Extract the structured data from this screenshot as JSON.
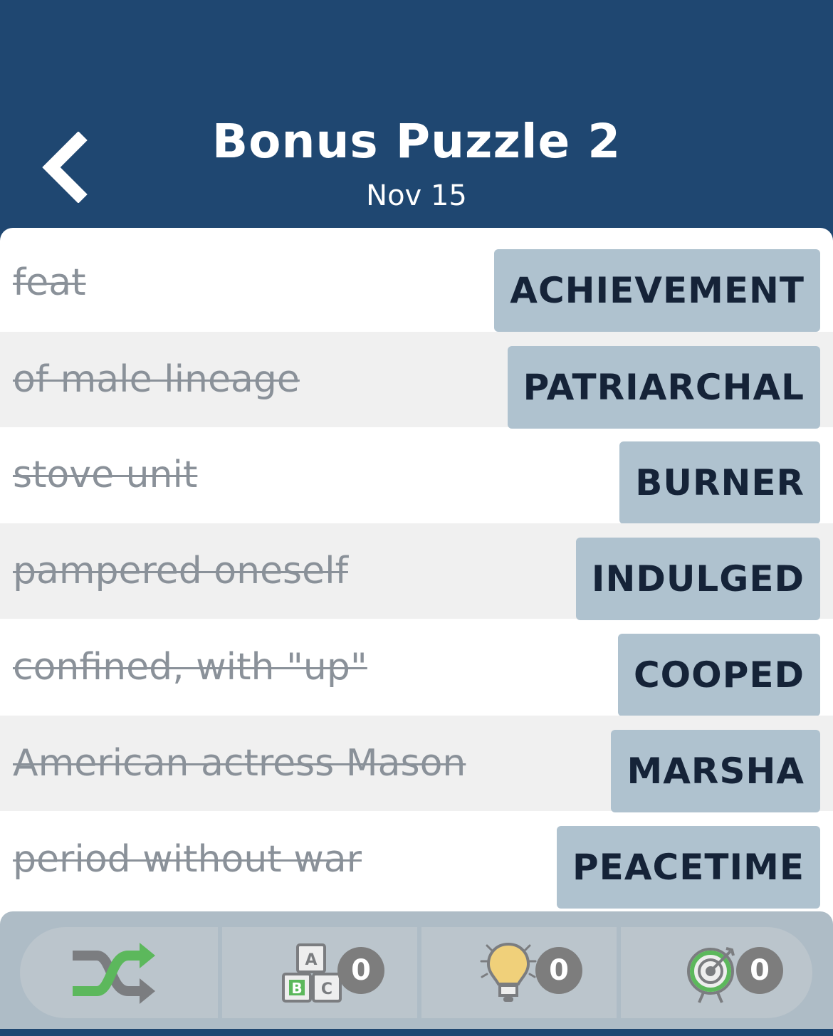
{
  "header": {
    "title": "Bonus Puzzle 2",
    "date": "Nov 15",
    "background_color": "#1f4771"
  },
  "clues": [
    {
      "clue": "feat",
      "answer": "ACHIEVEMENT",
      "solved": true
    },
    {
      "clue": "of male lineage",
      "answer": "PATRIARCHAL",
      "solved": true
    },
    {
      "clue": "stove unit",
      "answer": "BURNER",
      "solved": true
    },
    {
      "clue": "pampered oneself",
      "answer": "INDULGED",
      "solved": true
    },
    {
      "clue": "confined, with \"up\"",
      "answer": "COOPED",
      "solved": true
    },
    {
      "clue": "American actress Mason",
      "answer": "MARSHA",
      "solved": true
    },
    {
      "clue": "period without war",
      "answer": "PEACETIME",
      "solved": true
    }
  ],
  "toolbar": {
    "shuffle_icon": "shuffle-icon",
    "letters_icon": "abc-blocks-icon",
    "letters_count": "0",
    "hint_icon": "lightbulb-icon",
    "hint_count": "0",
    "target_icon": "target-icon",
    "target_count": "0",
    "block_letters": {
      "a": "A",
      "b": "B",
      "c": "C"
    }
  },
  "colors": {
    "answer_tile": "#afc2cf",
    "shuffle_green": "#5cb85c",
    "bulb_yellow": "#f0d07a"
  }
}
